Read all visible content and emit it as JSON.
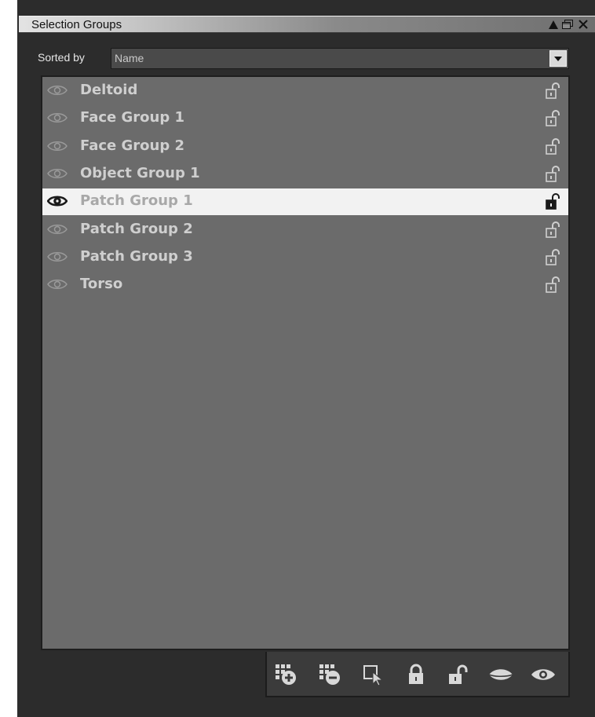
{
  "panel": {
    "title": "Selection Groups",
    "title_buttons": [
      "collapse-icon",
      "float-window-icon",
      "close-icon"
    ]
  },
  "sort": {
    "label": "Sorted by",
    "value": "Name"
  },
  "groups": [
    {
      "name": "Deltoid",
      "visible": true,
      "locked": false,
      "selected": false
    },
    {
      "name": "Face Group 1",
      "visible": true,
      "locked": false,
      "selected": false
    },
    {
      "name": "Face Group 2",
      "visible": true,
      "locked": false,
      "selected": false
    },
    {
      "name": "Object Group 1",
      "visible": true,
      "locked": false,
      "selected": false
    },
    {
      "name": "Patch Group 1",
      "visible": true,
      "locked": false,
      "selected": true
    },
    {
      "name": "Patch Group 2",
      "visible": true,
      "locked": false,
      "selected": false
    },
    {
      "name": "Patch Group 3",
      "visible": true,
      "locked": false,
      "selected": false
    },
    {
      "name": "Torso",
      "visible": true,
      "locked": false,
      "selected": false
    }
  ],
  "toolbar": {
    "buttons": [
      {
        "icon": "add-group-icon"
      },
      {
        "icon": "remove-group-icon"
      },
      {
        "icon": "select-group-icon"
      },
      {
        "icon": "lock-icon"
      },
      {
        "icon": "unlock-icon"
      },
      {
        "icon": "hide-icon"
      },
      {
        "icon": "show-icon"
      }
    ]
  },
  "colors": {
    "panel_bg": "#2c2c2c",
    "list_bg": "#6b6b6b",
    "selected_row_bg": "#f2f2f2",
    "row_text": "#cfcfcf"
  }
}
